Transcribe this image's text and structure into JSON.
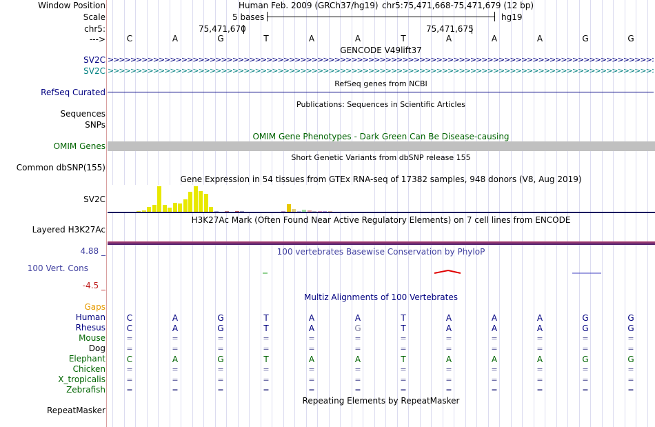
{
  "labels": {
    "window_position": "Window Position",
    "scale": "Scale",
    "chr": "chr5:",
    "strand": "--->",
    "sv2c_1": "SV2C",
    "sv2c_2": "SV2C",
    "refseq": "RefSeq Curated",
    "sequences": "Sequences",
    "snps": "SNPs",
    "omim": "OMIM Genes",
    "common_dbsnp": "Common dbSNP(155)",
    "sv2c_gtex": "SV2C",
    "h3k27ac": "Layered H3K27Ac",
    "phylop_max": "4.88 _",
    "phylop_label": "100 Vert. Cons",
    "phylop_min": "-4.5 _",
    "gaps": "Gaps",
    "species": [
      "Human",
      "Rhesus",
      "Mouse",
      "Dog",
      "Elephant",
      "Chicken",
      "X_tropicalis",
      "Zebrafish"
    ],
    "repeatmasker": "RepeatMasker"
  },
  "header": {
    "assembly": "Human Feb. 2009 (GRCh37/hg19)",
    "position": "chr5:75,471,668-75,471,679 (12 bp)",
    "scale_bar": "5 bases",
    "scale_db": "hg19",
    "coord1": "75,471,670",
    "coord2": "75,471,675"
  },
  "bases": [
    "C",
    "A",
    "G",
    "T",
    "A",
    "A",
    "T",
    "A",
    "A",
    "A",
    "G",
    "G"
  ],
  "tracks": {
    "gencode": "GENCODE V49lift37",
    "refseq_title": "RefSeq genes from NCBI",
    "publications": "Publications: Sequences in Scientific Articles",
    "omim_title": "OMIM Gene Phenotypes - Dark Green Can Be Disease-causing",
    "dbsnp_title": "Short Genetic Variants from dbSNP release 155",
    "gtex_title": "Gene Expression in 54 tissues from GTEx RNA-seq of 17382 samples, 948 donors (V8, Aug 2019)",
    "h3k27ac_title": "H3K27Ac Mark (Often Found Near Active Regulatory Elements) on 7 cell lines from ENCODE",
    "phylop_title": "100 vertebrates Basewise Conservation by PhyloP",
    "multiz_title": "Multiz Alignments of 100 Vertebrates",
    "repeat_title": "Repeating Elements by RepeatMasker"
  },
  "alignment": {
    "Human": [
      "C",
      "A",
      "G",
      "T",
      "A",
      "A",
      "T",
      "A",
      "A",
      "A",
      "G",
      "G"
    ],
    "Rhesus": [
      "C",
      "A",
      "G",
      "T",
      "A",
      "G",
      "T",
      "A",
      "A",
      "A",
      "G",
      "G"
    ],
    "Mouse": [
      "=",
      "=",
      "=",
      "=",
      "=",
      "=",
      "=",
      "=",
      "=",
      "=",
      "=",
      "="
    ],
    "Dog": [
      "=",
      "=",
      "=",
      "=",
      "=",
      "=",
      "=",
      "=",
      "=",
      "=",
      "=",
      "="
    ],
    "Elephant": [
      "C",
      "A",
      "G",
      "T",
      "A",
      "A",
      "T",
      "A",
      "A",
      "A",
      "G",
      "G"
    ],
    "Chicken": [
      "=",
      "=",
      "=",
      "=",
      "=",
      "=",
      "=",
      "=",
      "=",
      "=",
      "=",
      "="
    ],
    "X_tropicalis": [
      "=",
      "=",
      "=",
      "=",
      "=",
      "=",
      "=",
      "=",
      "=",
      "=",
      "=",
      "="
    ],
    "Zebrafish": [
      "=",
      "=",
      "=",
      "=",
      "=",
      "=",
      "=",
      "=",
      "=",
      "=",
      "=",
      "="
    ]
  },
  "gtex_bars": [
    {
      "v": 0.05,
      "c": "#e8e830"
    },
    {
      "v": 0.08,
      "c": "#e8e830"
    },
    {
      "v": 0.2,
      "c": "#e8e800"
    },
    {
      "v": 0.28,
      "c": "#e8e800"
    },
    {
      "v": 1.0,
      "c": "#e8e800"
    },
    {
      "v": 0.3,
      "c": "#e8e800"
    },
    {
      "v": 0.18,
      "c": "#e8e800"
    },
    {
      "v": 0.38,
      "c": "#e8e800"
    },
    {
      "v": 0.35,
      "c": "#e8e800"
    },
    {
      "v": 0.5,
      "c": "#e8e800"
    },
    {
      "v": 0.8,
      "c": "#e8e800"
    },
    {
      "v": 1.0,
      "c": "#e8e800"
    },
    {
      "v": 0.82,
      "c": "#e8e800"
    },
    {
      "v": 0.72,
      "c": "#e8e800"
    },
    {
      "v": 0.2,
      "c": "#e8e800"
    },
    {
      "v": 0.04,
      "c": "#b0b0d0"
    },
    {
      "v": 0.03,
      "c": "#c0a0a0"
    },
    {
      "v": 0.05,
      "c": "#c08080"
    },
    {
      "v": 0.03,
      "c": "#b0b0b0"
    },
    {
      "v": 0.05,
      "c": "#c06060"
    },
    {
      "v": 0.04,
      "c": "#a0a0c0"
    },
    {
      "v": 0.03,
      "c": "#c0a0c0"
    },
    {
      "v": 0.02,
      "c": "#b0b0b0"
    },
    {
      "v": 0.02,
      "c": "#a0a0d0"
    },
    {
      "v": 0.03,
      "c": "#c0a0a0"
    },
    {
      "v": 0.02,
      "c": "#b0b0b0"
    },
    {
      "v": 0.02,
      "c": "#a0c0a0"
    },
    {
      "v": 0.02,
      "c": "#a0a0c0"
    },
    {
      "v": 0.06,
      "c": "#c0a0c0"
    },
    {
      "v": 0.32,
      "c": "#e8c800"
    },
    {
      "v": 0.12,
      "c": "#e0d080"
    },
    {
      "v": 0.04,
      "c": "#c0c0e0"
    },
    {
      "v": 0.1,
      "c": "#a0e0a0"
    },
    {
      "v": 0.08,
      "c": "#e0a0a0"
    },
    {
      "v": 0.04,
      "c": "#c0c0c0"
    },
    {
      "v": 0.05,
      "c": "#e0a0c0"
    },
    {
      "v": 0.05,
      "c": "#c0a0e0"
    },
    {
      "v": 0.06,
      "c": "#e0c0a0"
    },
    {
      "v": 0.03,
      "c": "#a0a0c0"
    },
    {
      "v": 0.02,
      "c": "#b0b0b0"
    }
  ],
  "colors": {
    "navy": "#000080",
    "teal": "#008080",
    "omim_green": "#006400",
    "omim_bar": "#c0c0c0",
    "phylop_label": "#4040a0",
    "gaps": "#e69a00",
    "h3k_band": "#7a3050"
  }
}
